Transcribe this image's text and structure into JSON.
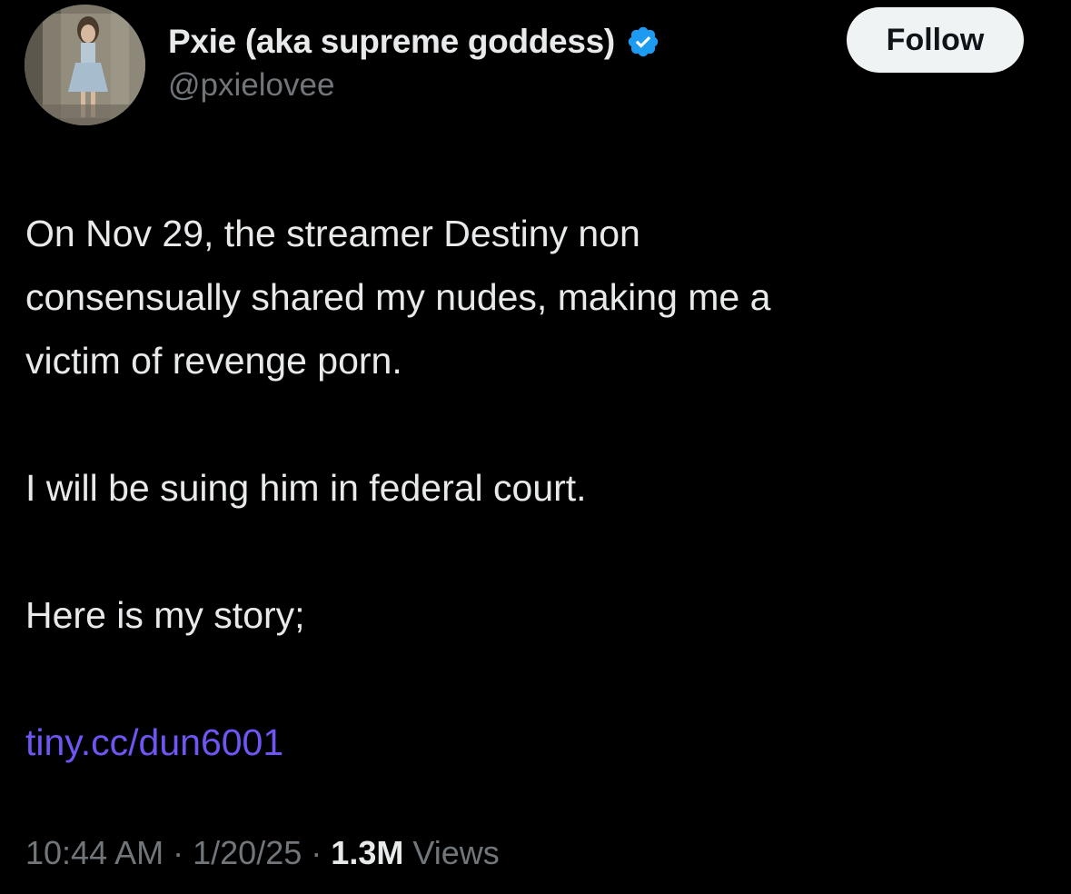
{
  "author": {
    "display_name": "Pxie (aka supreme goddess)",
    "handle": "@pxielovee",
    "verified_icon": "verified-badge-icon"
  },
  "follow_button": {
    "label": "Follow"
  },
  "tweet": {
    "paragraph_1_line_1": "On Nov 29, the streamer Destiny non",
    "paragraph_1_line_2": "consensually shared my nudes, making me a",
    "paragraph_1_line_3": "victim of revenge porn.",
    "paragraph_2": "I will be suing him in federal court.",
    "paragraph_3": "Here is my story;",
    "link_text": "tiny.cc/dun6001"
  },
  "meta": {
    "time": "10:44 AM",
    "separator": "·",
    "date": "1/20/25",
    "views_count": "1.3M",
    "views_label": "Views"
  },
  "colors": {
    "background": "#000000",
    "primary_text": "#e7e9ea",
    "secondary_text": "#71767b",
    "link": "#6e56f5",
    "verified_badge": "#1d9bf0",
    "follow_button_bg": "#eff3f4"
  }
}
